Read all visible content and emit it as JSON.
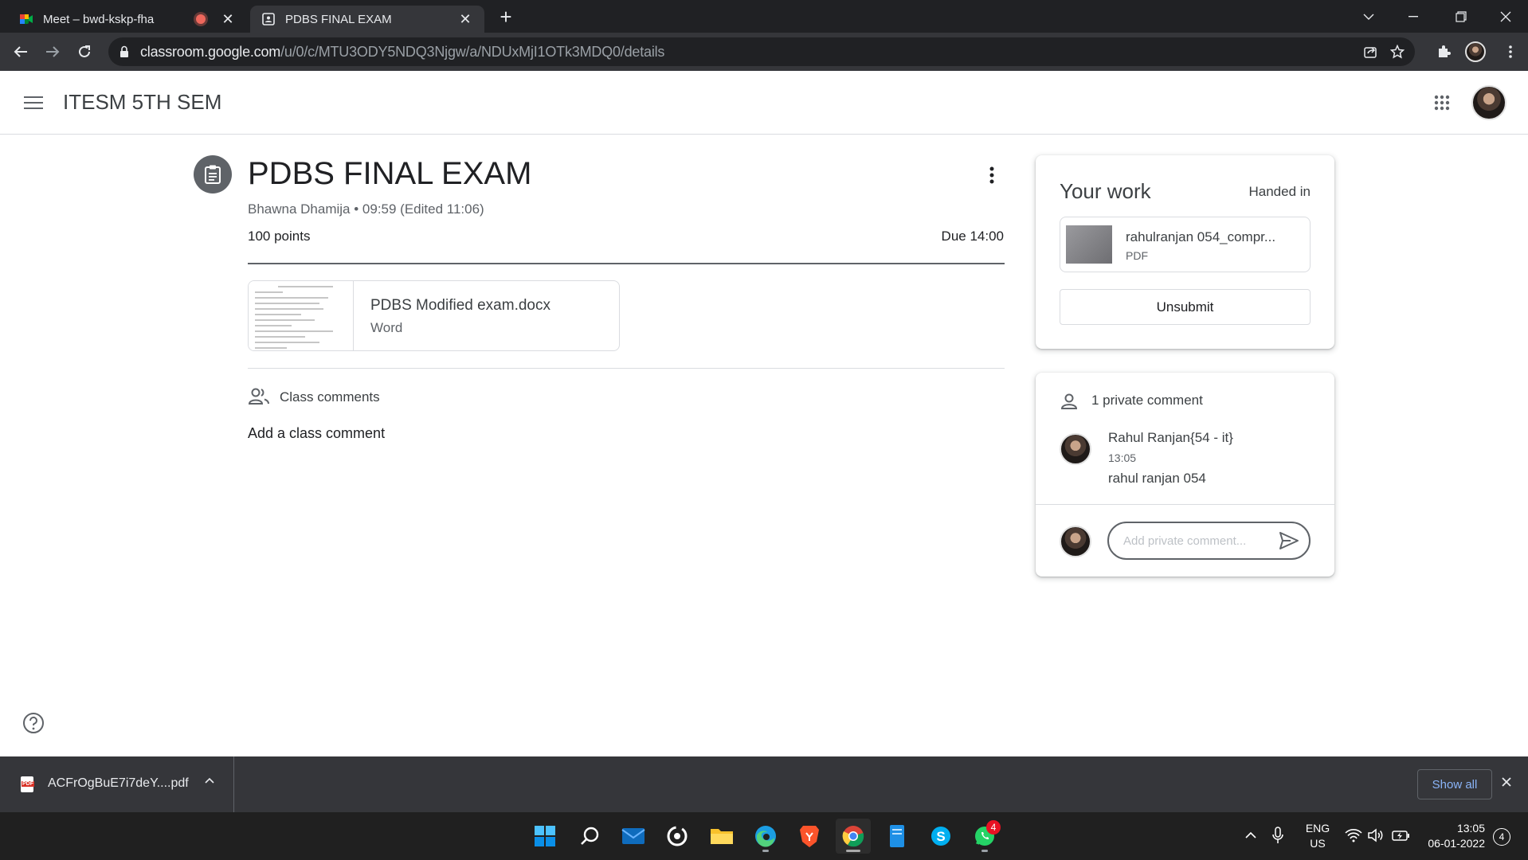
{
  "browser": {
    "tabs": [
      {
        "title": "Meet – bwd-kskp-fha",
        "recording": true
      },
      {
        "title": "PDBS FINAL EXAM",
        "active": true
      }
    ],
    "url_host": "classroom.google.com",
    "url_path": "/u/0/c/MTU3ODY5NDQ3Njgw/a/NDUxMjI1OTk3MDQ0/details"
  },
  "classroom": {
    "course_title": "ITESM 5TH SEM"
  },
  "assignment": {
    "title": "PDBS FINAL EXAM",
    "meta": "Bhawna Dhamija • 09:59 (Edited 11:06)",
    "points": "100 points",
    "due": "Due 14:00",
    "attachment": {
      "name": "PDBS Modified exam.docx",
      "type": "Word"
    }
  },
  "class_comments": {
    "label": "Class comments",
    "add": "Add a class comment"
  },
  "your_work": {
    "title": "Your work",
    "status": "Handed in",
    "file_name": "rahulranjan 054_compr...",
    "file_type": "PDF",
    "unsubmit_label": "Unsubmit"
  },
  "private_comments": {
    "header": "1 private comment",
    "comment": {
      "author": "Rahul Ranjan{54 - it}",
      "time": "13:05",
      "text": "rahul ranjan 054"
    },
    "placeholder": "Add private comment..."
  },
  "downloads": {
    "file": "ACFrOgBuE7i7deY....pdf",
    "show_all": "Show all"
  },
  "taskbar": {
    "lang_top": "ENG",
    "lang_bottom": "US",
    "time": "13:05",
    "date": "06-01-2022",
    "whatsapp_badge": "4",
    "notification_count": "4"
  },
  "colors": {
    "chrome_dark": "#202124",
    "chrome_toolbar": "#35363a",
    "text_primary": "#202124",
    "text_secondary": "#5f6368",
    "link_blue": "#8ab4f8"
  }
}
